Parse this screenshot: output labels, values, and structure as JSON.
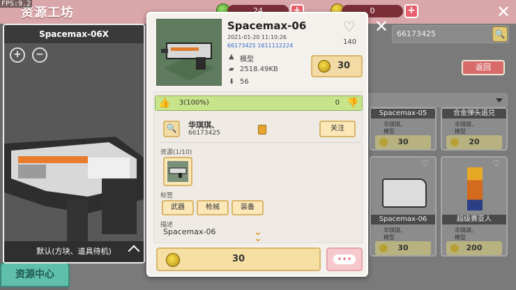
{
  "debug": {
    "fps": "FPS:9.2"
  },
  "header": {
    "title": "资源工坊",
    "currency_green": "24",
    "currency_gold": "0"
  },
  "preview": {
    "title": "Spacemax-06X",
    "zoom_in_icon": "zoom-in-icon",
    "zoom_out_icon": "zoom-out-icon",
    "footer_label": "默认(方块、道具待机)"
  },
  "left_nav": {
    "resource_center": "资源中心"
  },
  "search": {
    "value": "66173425"
  },
  "back_button": {
    "label": "返回"
  },
  "cards": [
    {
      "name": "Spacemax-05",
      "author": "华琪琪、",
      "type": "模型",
      "price": "30"
    },
    {
      "name": "合金弹头追兑",
      "author": "华琪琪、",
      "type": "模型",
      "price": "20"
    },
    {
      "name": "Spacemax-06",
      "author": "华琪琪、",
      "type": "模型",
      "price": "30"
    },
    {
      "name": "超级赛亚人",
      "author": "华琪琪、",
      "type": "模型",
      "price": "200"
    }
  ],
  "detail": {
    "title": "Spacemax-06",
    "date": "2021-01-20  11:10:26",
    "ids": "66173425  1611112224",
    "type_label": "模型",
    "size": "2518.49KB",
    "downloads": "56",
    "favorites": "140",
    "price": "30",
    "rating": {
      "likes_text": "3(100%)",
      "dislikes_text": "0",
      "like_fraction": 1.0
    },
    "author": {
      "name": "华琪琪、",
      "id": "66173425",
      "follow_label": "关注"
    },
    "resources_label": "资源(1/10)",
    "tags_label": "标签",
    "tags": [
      "武器",
      "枪械",
      "装备"
    ],
    "description_label": "描述",
    "description": "Spacemax-06",
    "buy_price": "30",
    "more_label": "•••"
  },
  "colors": {
    "topbar": "#d9a7aa",
    "modal_bg": "#f4f1ec",
    "button_gold": "#f6dfa2",
    "rating_green": "#c7e48a",
    "resource_tab": "#5fbfaa"
  }
}
